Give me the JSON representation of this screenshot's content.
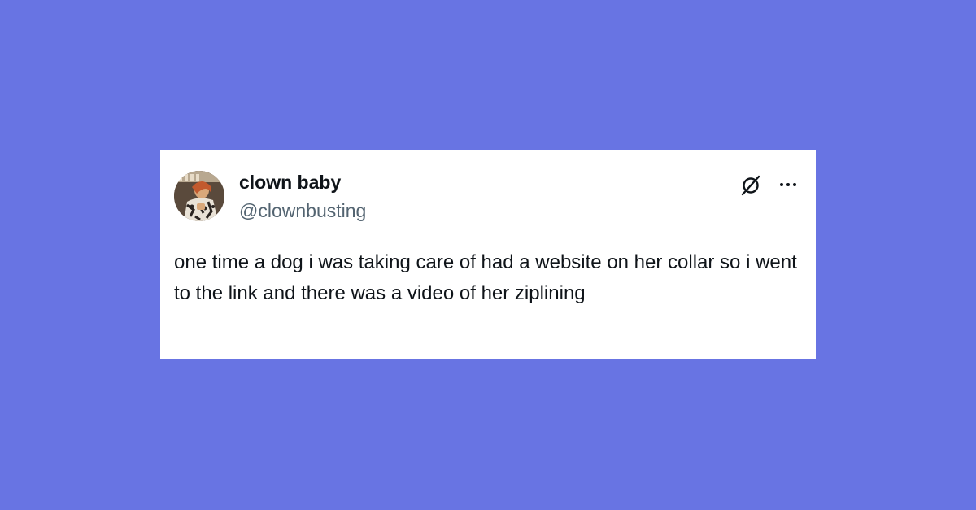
{
  "tweet": {
    "display_name": "clown baby",
    "handle": "@clownbusting",
    "text": "one time a dog i was taking care of had a website on her collar so i went to the link and there was a video of her ziplining"
  },
  "icons": {
    "avatar": "profile-photo",
    "platform": "x-logo-icon",
    "menu": "more-options-icon"
  },
  "colors": {
    "background": "#6874e3",
    "card": "#ffffff",
    "text_primary": "#0f1419",
    "text_secondary": "#536471"
  }
}
